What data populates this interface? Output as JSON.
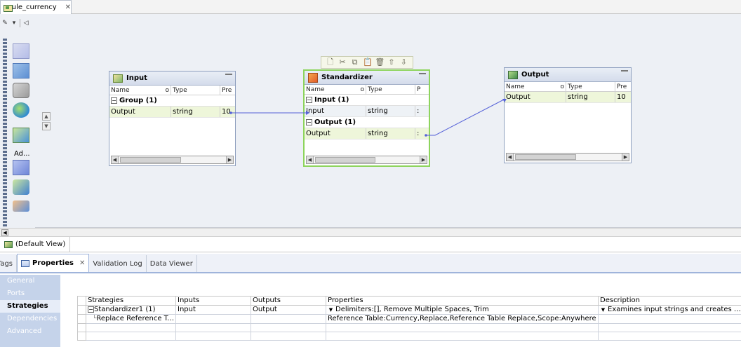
{
  "editor": {
    "tab_label": "rule_currency",
    "close_glyph": "✕"
  },
  "palette": {
    "ad_label": "Ad..."
  },
  "transforms": {
    "input": {
      "title": "Input",
      "columns": [
        "Name",
        "Type",
        "Pre"
      ],
      "groups": [
        {
          "label": "Group (1)",
          "ports": [
            {
              "name": "Output",
              "type": "string",
              "pre": "10"
            }
          ]
        }
      ]
    },
    "standardizer": {
      "title": "Standardizer",
      "columns": [
        "Name",
        "Type",
        "P"
      ],
      "groups": [
        {
          "label": "Input (1)",
          "ports": [
            {
              "name": "Input",
              "type": "string",
              "pre": ":"
            }
          ]
        },
        {
          "label": "Output (1)",
          "ports": [
            {
              "name": "Output",
              "type": "string",
              "pre": ":"
            }
          ]
        }
      ]
    },
    "output": {
      "title": "Output",
      "columns": [
        "Name",
        "Type",
        "Pre"
      ],
      "ports": [
        {
          "name": "Output",
          "type": "string",
          "pre": "10"
        }
      ]
    }
  },
  "default_view": {
    "label": "(Default View)"
  },
  "props_tabs": {
    "tags": "Tags",
    "properties": "Properties",
    "close_glyph": "✕",
    "validation_log": "Validation Log",
    "data_viewer": "Data Viewer"
  },
  "props_sidebar": {
    "items": [
      "General",
      "Ports",
      "Strategies",
      "Dependencies",
      "Advanced"
    ]
  },
  "strategies": {
    "headers": [
      "Strategies",
      "Inputs",
      "Outputs",
      "Properties",
      "Description"
    ],
    "rows": [
      {
        "strategy": "Standardizer1 (1)",
        "inputs": "Input",
        "outputs": "Output",
        "properties": "Delimiters:[], Remove Multiple Spaces, Trim",
        "description": "Examines input strings and creates standardiz..."
      },
      {
        "strategy": "Replace Reference Ta...",
        "inputs": "",
        "outputs": "",
        "properties": "Reference Table:Currency,Replace,Reference Table Replace,Scope:Anywhere",
        "description": ""
      }
    ]
  },
  "colors": {
    "canvas_bg": "#edf0f5",
    "selection_green": "#8dd45c",
    "link_blue": "#4a5adf",
    "sidebar_blue": "#c5d3ea"
  }
}
